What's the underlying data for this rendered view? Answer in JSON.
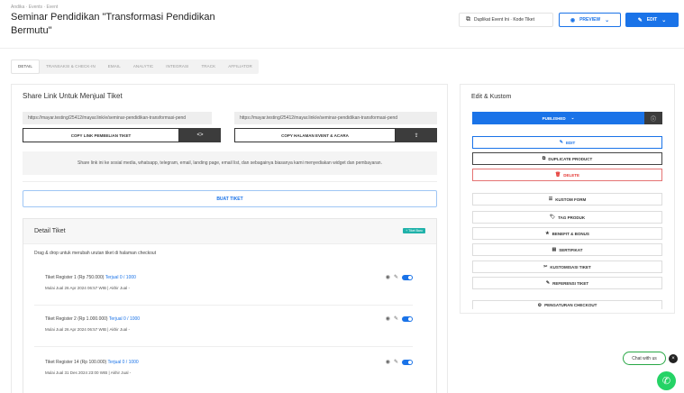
{
  "breadcrumb": "Andika · Events · Event",
  "page_title": "Seminar Pendidikan \"Transformasi Pendidikan Bermutu\"",
  "header": {
    "copy_title_label": "Duplikat Event Ini · Kode Tiket",
    "preview_label": "PREVIEW",
    "edit_label": "EDIT"
  },
  "tabs": [
    {
      "label": "DETAIL"
    },
    {
      "label": "TRANSAKSI & CHECK-IN"
    },
    {
      "label": "EMAIL"
    },
    {
      "label": "ANALYTIC"
    },
    {
      "label": "INTEGRASI"
    },
    {
      "label": "TRACK"
    },
    {
      "label": "AFFILIATOR"
    }
  ],
  "share": {
    "title": "Share Link Untuk Menjual Tiket",
    "link1": "https://mayar.testing/25412/mayar.link/e/seminar-pendidikan-transformasi-pend",
    "link2": "https://mayar.testing/25412/mayar.link/e/seminar-pendidikan-transformasi-pend",
    "copy1_label": "COPY LINK PEMBELIAN TIKET",
    "copy2_label": "COPY HALAMAN EVENT & ACARA",
    "info_text": "Share link ini ke sosial media, whatsapp, telegram, email, landing page, email list, dan sebagainya biasanya kami menyediakan widget dan pembayaran.",
    "create_ticket_label": "BUAT TIKET"
  },
  "detail": {
    "title": "Detail Tiket",
    "badge": "+ Tiket Baru",
    "note": "Drag & drop untuk merubah urutan tiket di halaman checkout",
    "tickets": [
      {
        "name": "Tiket Register 1 (Rp 750.000)",
        "sold": "Terjual 0 / 1000",
        "date": "Mulai Jual 26 Apr 2024 06:57 WIB | Akhir Jual -"
      },
      {
        "name": "Tiket Register 2 (Rp 1.000.000)",
        "sold": "Terjual 0 / 1000",
        "date": "Mulai Jual 26 Apr 2024 06:57 WIB | Akhir Jual -"
      },
      {
        "name": "Tiket Register 14 (Rp 100.000)",
        "sold": "Terjual 0 / 1000",
        "date": "Mulai Jual 31 Des 2024 23:00 WIB | Akhir Jual -"
      }
    ]
  },
  "edit_panel": {
    "title": "Edit & Kustom",
    "publish_label": "PUBLISHED",
    "actions": [
      {
        "label": "EDIT",
        "icon": "✎"
      },
      {
        "label": "DUPLICATE PRODUCT",
        "icon": "⧉"
      },
      {
        "label": "DELETE",
        "icon": "🗑"
      },
      {
        "label": "KUSTOM FORM",
        "icon": "☰"
      },
      {
        "label": "TAG PRODUK",
        "icon": "🏷"
      },
      {
        "label": "BENEFIT & BONUS",
        "icon": "★"
      },
      {
        "label": "SERTIFIKAT",
        "icon": "▤"
      },
      {
        "label": "KUSTOMISASI TIKET",
        "icon": "✂"
      },
      {
        "label": "REFERENSI TIKET",
        "icon": "✎"
      },
      {
        "label": "PENGATURAN CHECKOUT",
        "icon": "⚙"
      }
    ]
  },
  "chat": {
    "label": "Chat with us"
  },
  "colors": {
    "primary": "#1a73e8",
    "dark": "#3c3c3c",
    "danger": "#e53935",
    "whatsapp": "#25d366"
  }
}
